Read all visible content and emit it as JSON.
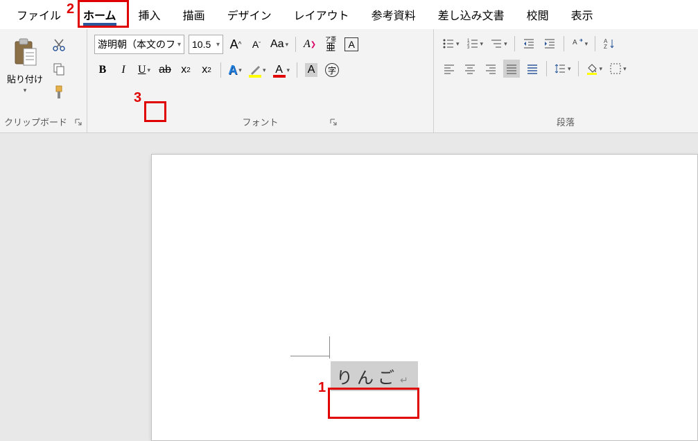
{
  "tabs": {
    "file": "ファイル",
    "home": "ホーム",
    "insert": "挿入",
    "draw": "描画",
    "design": "デザイン",
    "layout": "レイアウト",
    "references": "参考資料",
    "mailings": "差し込み文書",
    "review": "校閲",
    "view": "表示"
  },
  "clipboard": {
    "paste": "貼り付け",
    "group_label": "クリップボード"
  },
  "font": {
    "name": "游明朝（本文のフ",
    "size": "10.5",
    "group_label": "フォント",
    "bold": "B",
    "italic": "I",
    "underline": "U",
    "strike": "ab",
    "subscript": "x",
    "sub_num": "2",
    "superscript": "x",
    "sup_num": "2",
    "grow": "A",
    "shrink": "A",
    "case": "Aa",
    "ruby": "ア亜",
    "border_char": "A",
    "text_effects": "A",
    "highlight": "A",
    "font_color": "A",
    "shade": "A",
    "circled": "字"
  },
  "paragraph": {
    "group_label": "段落",
    "sort": "A↓Z"
  },
  "document": {
    "text": "りんご"
  },
  "annotations": {
    "n1": "1",
    "n2": "2",
    "n3": "3"
  }
}
